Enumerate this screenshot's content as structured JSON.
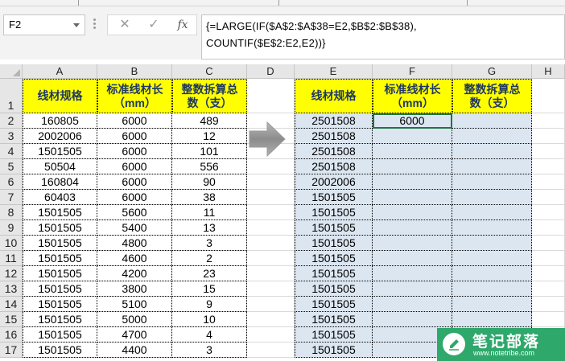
{
  "name_box": "F2",
  "fx_label": "fx",
  "formula_lines": [
    "{=LARGE(IF($A$2:$A$38=E2,$B$2:$B$38),",
    "COUNTIF($E$2:E2,E2))}"
  ],
  "columns": [
    "A",
    "B",
    "C",
    "D",
    "E",
    "F",
    "G",
    "H"
  ],
  "rows": [
    "1",
    "2",
    "3",
    "4",
    "5",
    "6",
    "7",
    "8",
    "9",
    "10",
    "11",
    "12",
    "13",
    "14",
    "15",
    "16",
    "17"
  ],
  "left_headers": [
    "线材规格",
    "标准线材长\n（mm）",
    "整数拆算总\n数（支）"
  ],
  "right_headers": [
    "线材规格",
    "标准线材长\n（mm）",
    "整数拆算总\n数（支）"
  ],
  "left_data": [
    [
      "160805",
      "6000",
      "489"
    ],
    [
      "2002006",
      "6000",
      "12"
    ],
    [
      "1501505",
      "6000",
      "101"
    ],
    [
      "50504",
      "6000",
      "556"
    ],
    [
      "160804",
      "6000",
      "90"
    ],
    [
      "60403",
      "6000",
      "38"
    ],
    [
      "1501505",
      "5600",
      "11"
    ],
    [
      "1501505",
      "5400",
      "13"
    ],
    [
      "1501505",
      "4800",
      "3"
    ],
    [
      "1501505",
      "4600",
      "2"
    ],
    [
      "1501505",
      "4200",
      "23"
    ],
    [
      "1501505",
      "3800",
      "15"
    ],
    [
      "1501505",
      "5100",
      "9"
    ],
    [
      "1501505",
      "5000",
      "10"
    ],
    [
      "1501505",
      "4700",
      "4"
    ],
    [
      "1501505",
      "4400",
      "3"
    ]
  ],
  "right_e": [
    "2501508",
    "2501508",
    "2501508",
    "2501508",
    "2002006",
    "1501505",
    "1501505",
    "1501505",
    "1501505",
    "1501505",
    "1501505",
    "1501505",
    "1501505",
    "1501505",
    "1501505",
    "1501505"
  ],
  "right_f2": "6000",
  "watermark": {
    "title": "笔记部落",
    "url": "www.notetribe.com"
  },
  "colors": {
    "header_fill": "#ffff00",
    "header_text": "#1f3864",
    "result_fill": "#dce6f1",
    "watermark": "#2ea86b"
  }
}
